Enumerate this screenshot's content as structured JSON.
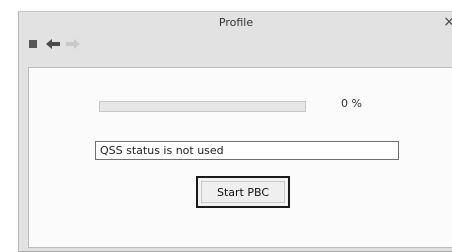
{
  "window": {
    "title": "Profile",
    "close_glyph": "×"
  },
  "toolbar": {
    "icons": [
      "stop-icon",
      "back-arrow-icon",
      "forward-arrow-icon"
    ]
  },
  "progress": {
    "value_percent": 0,
    "label": "0 %"
  },
  "status": {
    "value": "QSS status is not used"
  },
  "actions": {
    "start_pbc_label": "Start PBC"
  }
}
